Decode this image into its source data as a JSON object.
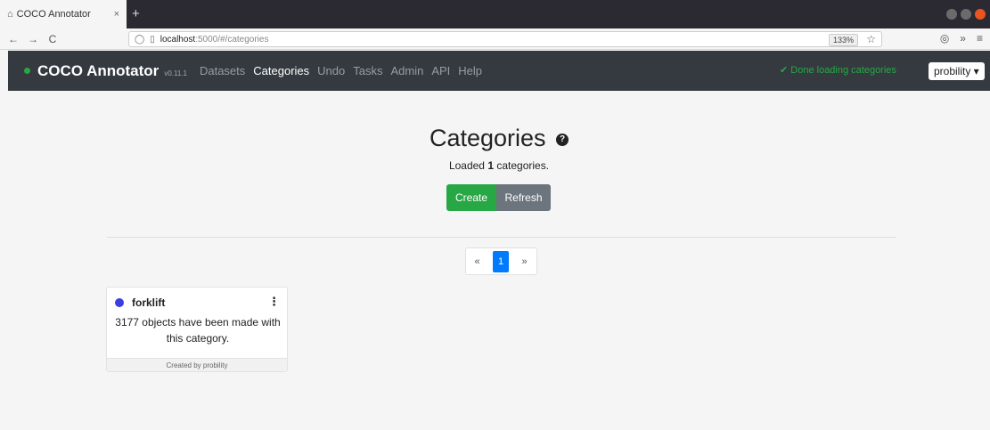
{
  "browser": {
    "tab_title": "COCO Annotator",
    "tab_close": "×",
    "new_tab": "+",
    "back": "←",
    "forward": "→",
    "reload": "C",
    "url_host": "localhost",
    "url_path": ":5000/#/categories",
    "zoom": "133%",
    "star": "☆",
    "pocket": "◎",
    "more": "»",
    "menu": "≡"
  },
  "app": {
    "brand": "COCO Annotator",
    "version": "v0.11.1",
    "menu": [
      "Datasets",
      "Categories",
      "Undo",
      "Tasks",
      "Admin",
      "API",
      "Help"
    ],
    "active_menu": "Categories",
    "status": "✔ Done loading categories",
    "user": "probility ▾"
  },
  "main": {
    "title": "Categories",
    "help_icon": "?",
    "loaded_prefix": "Loaded ",
    "loaded_count": "1",
    "loaded_suffix": " categories.",
    "create_label": "Create",
    "refresh_label": "Refresh",
    "pager": {
      "prev": "«",
      "current": "1",
      "next": "»"
    }
  },
  "categories": [
    {
      "name": "forklift",
      "color": "#3a3ee0",
      "menu": "⋮",
      "description": "3177 objects have been made with this category.",
      "footer": "Created by probility"
    }
  ],
  "colors": {
    "header_bg": "#343a40",
    "success": "#28a745",
    "secondary": "#6c757d",
    "primary": "#007bff"
  }
}
